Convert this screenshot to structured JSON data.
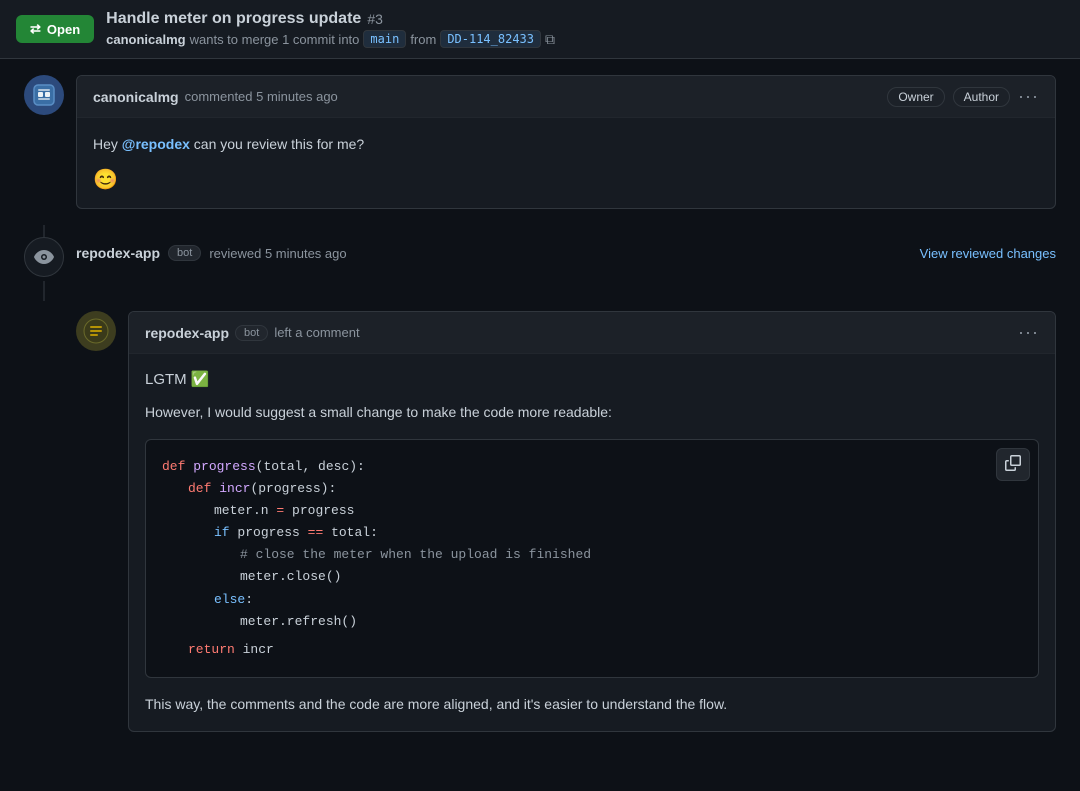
{
  "topbar": {
    "open_label": "Open",
    "pr_title": "Handle meter on progress update",
    "pr_number": "#3",
    "meta_text": "wants to merge 1 commit into",
    "author": "canonicalmg",
    "base_branch": "main",
    "from_text": "from",
    "head_branch": "DD-114_82433"
  },
  "first_comment": {
    "author": "canonicalmg",
    "action": "commented 5 minutes ago",
    "badge_owner": "Owner",
    "badge_author": "Author",
    "body": "Hey @repodex can you review this for me?",
    "mention": "@repodex"
  },
  "review": {
    "reviewer": "repodex-app",
    "bot_label": "bot",
    "action": "reviewed 5 minutes ago",
    "view_changes": "View reviewed changes",
    "comment_action": "left a comment",
    "lgtm": "LGTM ✅",
    "suggestion": "However, I would suggest a small change to make the code more readable:",
    "code_lines": [
      {
        "indent": 0,
        "content": "def progress(total, desc):"
      },
      {
        "indent": 1,
        "content": "def incr(progress):"
      },
      {
        "indent": 2,
        "content": "meter.n = progress"
      },
      {
        "indent": 2,
        "content": "if progress == total:"
      },
      {
        "indent": 3,
        "content": "# close the meter when the upload is finished"
      },
      {
        "indent": 3,
        "content": "meter.close()"
      },
      {
        "indent": 2,
        "content": "else:"
      },
      {
        "indent": 3,
        "content": "meter.refresh()"
      },
      {
        "indent": 0,
        "content": ""
      },
      {
        "indent": 1,
        "content": "return incr"
      }
    ],
    "bottom_text": "This way, the comments and the code are more aligned, and it's easier to understand the flow."
  },
  "icons": {
    "merge": "⇄",
    "eye": "👁",
    "copy": "⧉",
    "more": "···",
    "smile": "😊"
  }
}
